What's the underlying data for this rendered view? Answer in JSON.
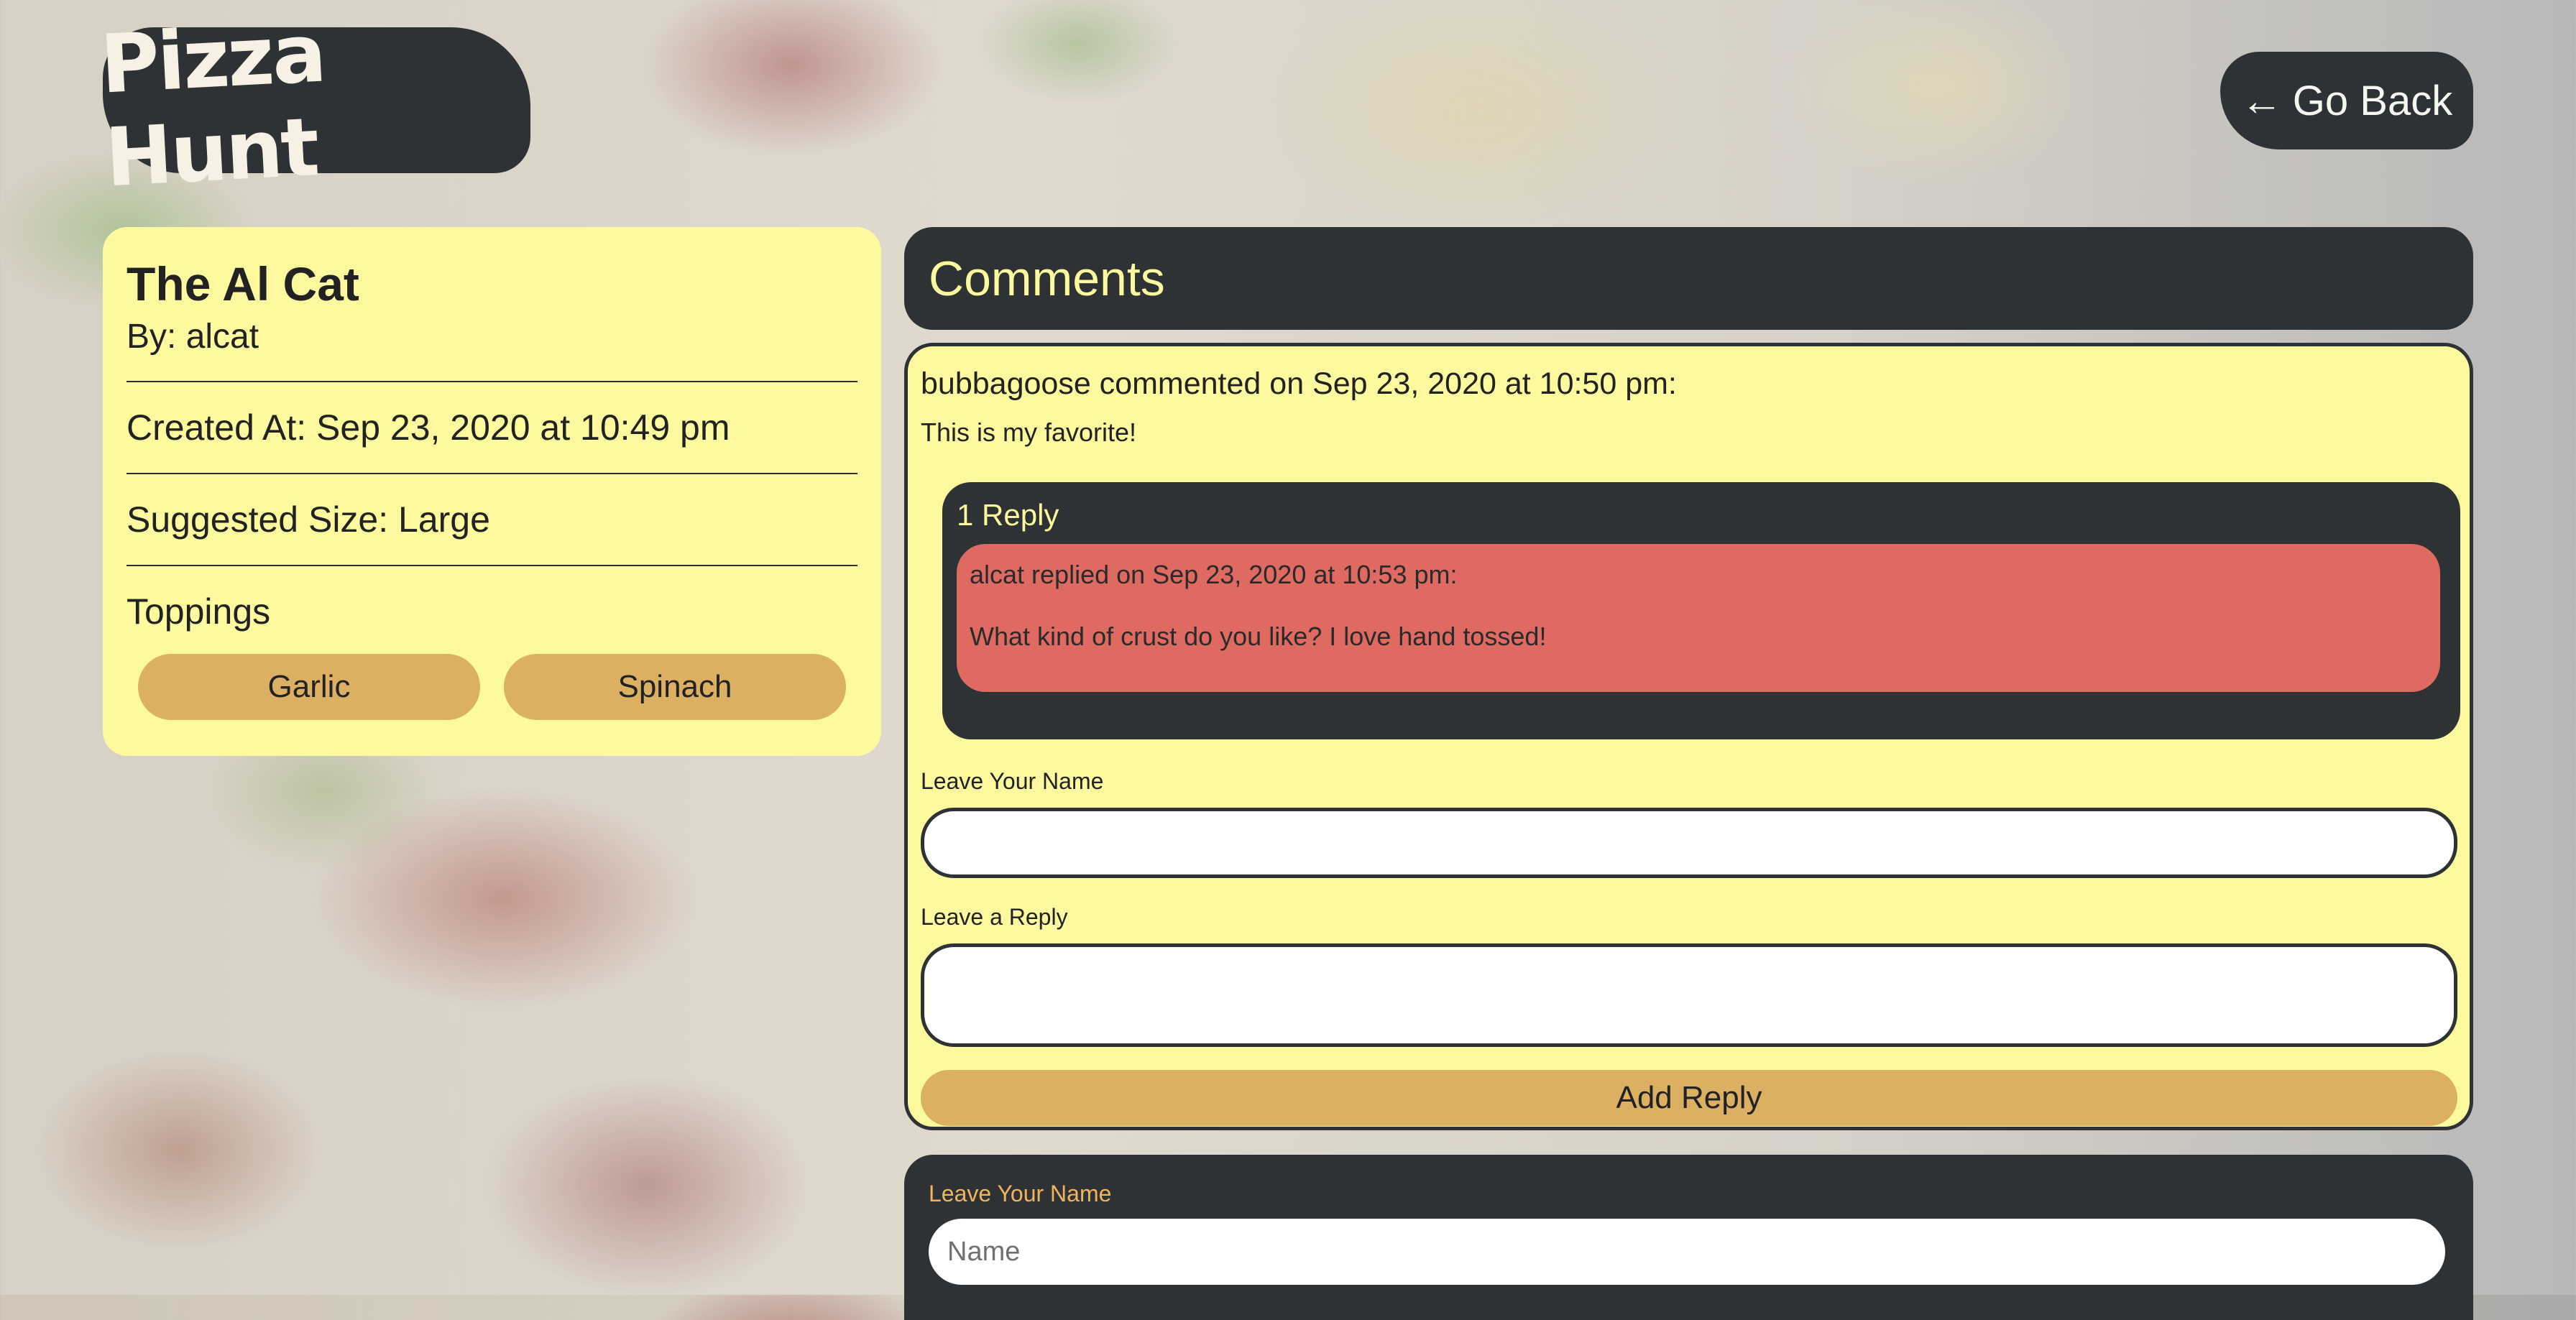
{
  "header": {
    "logo_text": "Pizza Hunt",
    "go_back_arrow": "←",
    "go_back_label": "Go Back"
  },
  "pizza": {
    "name": "The Al Cat",
    "author": "By: alcat",
    "created_at": "Created At: Sep 23, 2020 at 10:49 pm",
    "suggested_size": "Suggested Size: Large",
    "toppings_label": "Toppings",
    "toppings": [
      "Garlic",
      "Spinach"
    ]
  },
  "comments": {
    "header": "Comments",
    "items": [
      {
        "meta": "bubbagoose commented on Sep 23, 2020 at 10:50 pm:",
        "body": "This is my favorite!",
        "reply_count": "1 Reply",
        "replies": [
          {
            "meta": "alcat replied on Sep 23, 2020 at 10:53 pm:",
            "body": "What kind of crust do you like? I love hand tossed!"
          }
        ],
        "form": {
          "name_label": "Leave Your Name",
          "name_value": "",
          "reply_label": "Leave a Reply",
          "reply_value": "",
          "submit_label": "Add Reply"
        }
      }
    ]
  },
  "new_comment": {
    "name_label": "Leave Your Name",
    "name_placeholder": "Name"
  },
  "colors": {
    "dark": "#2f3235",
    "yellow": "#fdf99e",
    "tan": "#dcb063",
    "reply_red": "#df6a61",
    "label_orange": "#f0b45c"
  },
  "icons": {
    "back": "arrow-left-icon"
  }
}
